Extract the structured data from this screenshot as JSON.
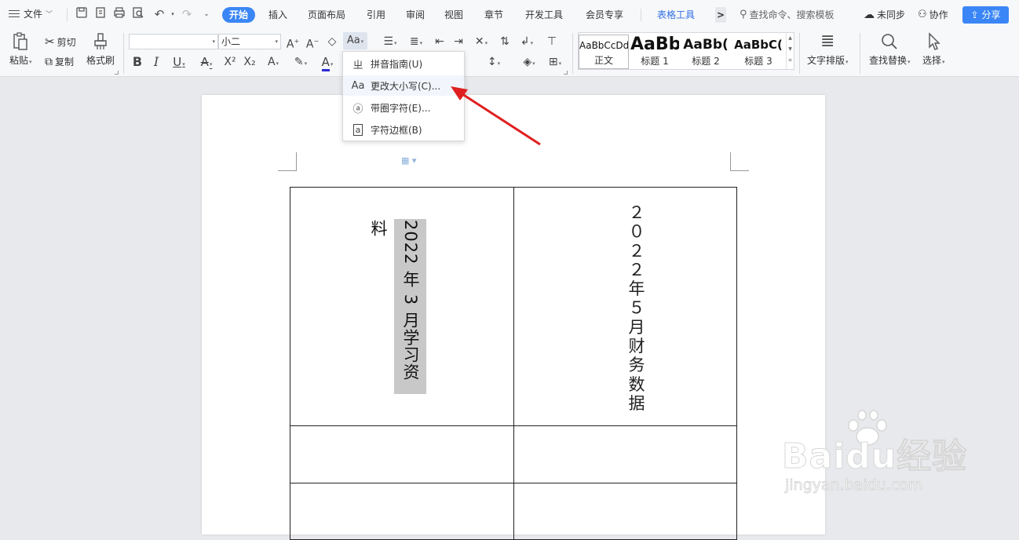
{
  "menubar": {
    "file_label": "文件",
    "tabs": [
      {
        "label": "开始",
        "active": true
      },
      {
        "label": "插入"
      },
      {
        "label": "页面布局"
      },
      {
        "label": "引用"
      },
      {
        "label": "审阅"
      },
      {
        "label": "视图"
      },
      {
        "label": "章节"
      },
      {
        "label": "开发工具"
      },
      {
        "label": "会员专享"
      },
      {
        "label": "表格工具",
        "tool": true
      }
    ],
    "more": ">",
    "search_placeholder": "查找命令、搜索模板",
    "sync_label": "未同步",
    "collab_label": "协作",
    "share_label": "分享"
  },
  "ribbon": {
    "paste": "粘贴",
    "cut": "剪切",
    "copy": "复制",
    "format_painter": "格式刷",
    "font_name": "",
    "font_size": "小二",
    "change_case_button": "Aa",
    "styles": [
      {
        "sample": "AaBbCcDd",
        "label": "正文"
      },
      {
        "sample": "AaBb",
        "label": "标题 1"
      },
      {
        "sample": "AaBb(",
        "label": "标题 2"
      },
      {
        "sample": "AaBbC(",
        "label": "标题 3"
      }
    ],
    "text_layout": "文字排版",
    "find_replace": "查找替换",
    "select": "选择"
  },
  "dropdown": {
    "items": [
      {
        "icon": "pinyin-icon",
        "label": "拼音指南(U)"
      },
      {
        "icon": "change-case-icon",
        "label": "更改大小写(C)..."
      },
      {
        "icon": "enclosed-char-icon",
        "label": "带圈字符(E)..."
      },
      {
        "icon": "char-border-icon",
        "label": "字符边框(B)"
      }
    ]
  },
  "document": {
    "cell_left_text": "2022 年 3 月学习资料",
    "cell_right_text": "２０２２年５月财务数据"
  },
  "watermark": {
    "logo": "Baidu经验",
    "url": "jingyan.baidu.com"
  },
  "colors": {
    "accent": "#3a86f6",
    "arrow": "#e02020",
    "selection": "#c8c8c8"
  }
}
